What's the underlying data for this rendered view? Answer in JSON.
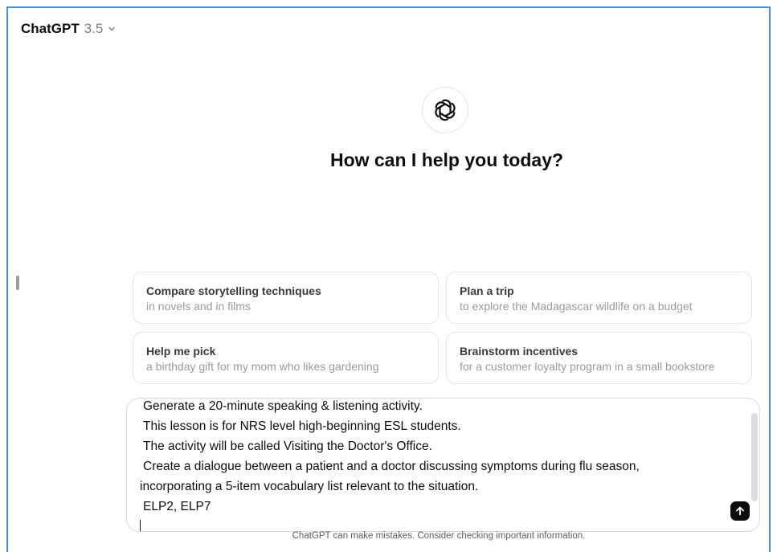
{
  "header": {
    "app_name": "ChatGPT",
    "version": "3.5",
    "dropdown_icon": "chevron-down-icon"
  },
  "main": {
    "logo_icon": "openai-logo-icon",
    "headline": "How can I help you today?"
  },
  "suggestions": [
    {
      "title": "Compare storytelling techniques",
      "subtitle": "in novels and in films"
    },
    {
      "title": "Plan a trip",
      "subtitle": "to explore the Madagascar wildlife on a budget"
    },
    {
      "title": "Help me pick",
      "subtitle": "a birthday gift for my mom who likes gardening"
    },
    {
      "title": "Brainstorm incentives",
      "subtitle": "for a customer loyalty program in a small bookstore"
    }
  ],
  "composer": {
    "lines": [
      "Generate a 20-minute speaking & listening activity.",
      "This lesson is for NRS level high-beginning ESL students.",
      "The activity will be called Visiting the Doctor's Office.",
      "Create a dialogue between a patient and a doctor discussing symptoms during flu season,",
      "incorporating a 5-item vocabulary list relevant to the situation.",
      "ELP2, ELP7"
    ],
    "send_icon": "arrow-up-icon"
  },
  "footer": {
    "disclaimer": "ChatGPT can make mistakes. Consider checking important information."
  },
  "colors": {
    "frame_border": "#4a90d9",
    "send_button": "#0d0d0d",
    "muted_text": "#9a9a9a"
  }
}
